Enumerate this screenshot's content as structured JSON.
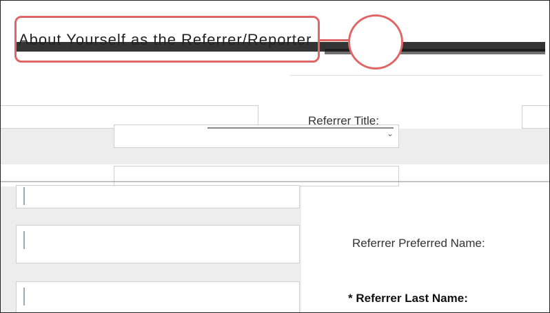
{
  "section": {
    "title": "About Yourself as the Referrer/Reporter"
  },
  "form": {
    "title_label": "Referrer Title:",
    "preferred_name_label": "Referrer Preferred Name:",
    "last_name_label": "* Referrer Last Name:"
  },
  "colors": {
    "annotation": "#e06666",
    "row_bg": "#ededed"
  }
}
